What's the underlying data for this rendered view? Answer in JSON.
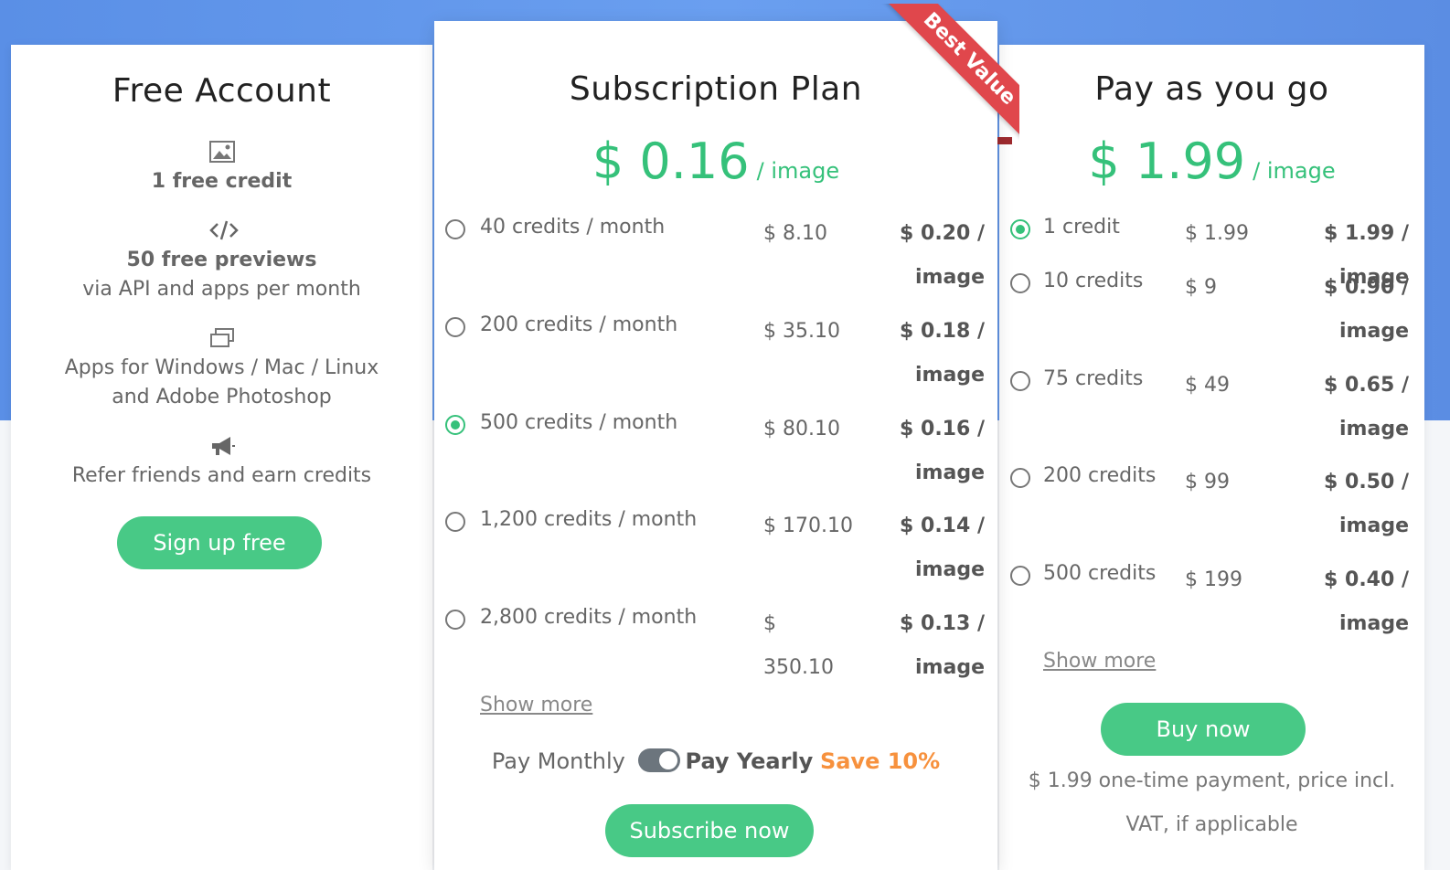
{
  "free": {
    "title": "Free Account",
    "feature1_bold": "1 free credit",
    "feature2_bold": "50 free previews",
    "feature2_text": "via API and apps per month",
    "feature3_line1": "Apps for Windows / Mac / Linux",
    "feature3_line2": "and Adobe Photoshop",
    "feature4_text": "Refer friends and earn credits",
    "button": "Sign up free"
  },
  "subscription": {
    "ribbon": "Best Value",
    "title": "Subscription Plan",
    "price": "$ 0.16",
    "unit": "/ image",
    "rows": [
      {
        "label": "40 credits / month",
        "price": "$ 8.10",
        "per1": "$ 0.20 /",
        "per2": "image",
        "selected": false
      },
      {
        "label": "200 credits / month",
        "price": "$ 35.10",
        "per1": "$ 0.18 /",
        "per2": "image",
        "selected": false
      },
      {
        "label": "500 credits / month",
        "price": "$ 80.10",
        "per1": "$ 0.16 /",
        "per2": "image",
        "selected": true
      },
      {
        "label": "1,200 credits / month",
        "price": "$ 170.10",
        "per1": "$ 0.14 /",
        "per2": "image",
        "selected": false
      },
      {
        "label": "2,800 credits / month",
        "price": "$",
        "price2": "350.10",
        "per1": "$ 0.13 /",
        "per2": "image",
        "selected": false
      }
    ],
    "show_more": "Show more",
    "pay_monthly": "Pay Monthly",
    "pay_yearly": "Pay Yearly",
    "save": "Save 10%",
    "button": "Subscribe now"
  },
  "payg": {
    "title": "Pay as you go",
    "price": "$ 1.99",
    "unit": "/ image",
    "rows": [
      {
        "label": "1 credit",
        "price": "$ 1.99",
        "per1": "$ 1.99 / image",
        "per2": "",
        "selected": true
      },
      {
        "label": "10 credits",
        "price": "$ 9",
        "per1": "$ 0.90 /",
        "per2": "image",
        "selected": false
      },
      {
        "label": "75 credits",
        "price": "$ 49",
        "per1": "$ 0.65 /",
        "per2": "image",
        "selected": false
      },
      {
        "label": "200 credits",
        "price": "$ 99",
        "per1": "$ 0.50 /",
        "per2": "image",
        "selected": false
      },
      {
        "label": "500 credits",
        "price": "$ 199",
        "per1": "$ 0.40 /",
        "per2": "image",
        "selected": false
      }
    ],
    "show_more": "Show more",
    "button": "Buy now",
    "note1": "$ 1.99 one-time payment, price incl.",
    "note2": "VAT, if applicable"
  },
  "colors": {
    "accent": "#35c17a",
    "button": "#48c986",
    "ribbon": "#e0474c",
    "save": "#f7913d",
    "hero": "#5a8fe6"
  },
  "icons": [
    "image-icon",
    "code-icon",
    "windows-icon",
    "megaphone-icon"
  ]
}
